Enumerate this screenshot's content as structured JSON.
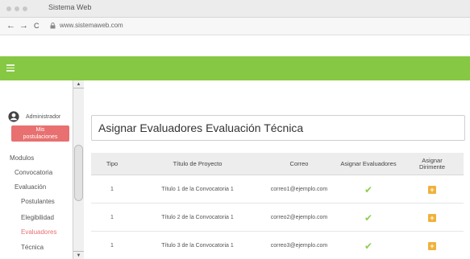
{
  "browser": {
    "tab_title": "Sistema Web",
    "url": "www.sistemaweb.com",
    "back_icon": "←",
    "forward_icon": "→",
    "reload_icon": "C"
  },
  "sidebar": {
    "user_name": "Administrador",
    "red_button": "Mis\npostulaciones",
    "items": [
      {
        "label": "Modulos"
      },
      {
        "label": "Convocatoria"
      },
      {
        "label": "Evaluación"
      },
      {
        "label": "Postulantes"
      },
      {
        "label": "Elegibilidad"
      },
      {
        "label": "Evaluadores"
      },
      {
        "label": "Técnica"
      }
    ]
  },
  "main": {
    "title": "Asignar Evaluadores Evaluación Técnica",
    "columns": [
      "Tipo",
      "Título de Proyecto",
      "Correo",
      "Asignar Evaluadores",
      "Asignar\nDirimente"
    ],
    "rows": [
      {
        "tipo": "1",
        "titulo": "Título 1 de la Convocatoria 1",
        "correo": "correo1@ejemplo.com"
      },
      {
        "tipo": "1",
        "titulo": "Título 2 de la Convocatoria 1",
        "correo": "correo2@ejemplo.com"
      },
      {
        "tipo": "1",
        "titulo": "Título 3 de la Convocatoria 1",
        "correo": "correo3@ejemplo.com"
      }
    ],
    "check_glyph": "✔",
    "plus_glyph": "+"
  },
  "colors": {
    "header_green": "#86c843",
    "red_button": "#e87070",
    "check_green": "#8ccf4f",
    "plus_orange": "#f0b13a"
  }
}
